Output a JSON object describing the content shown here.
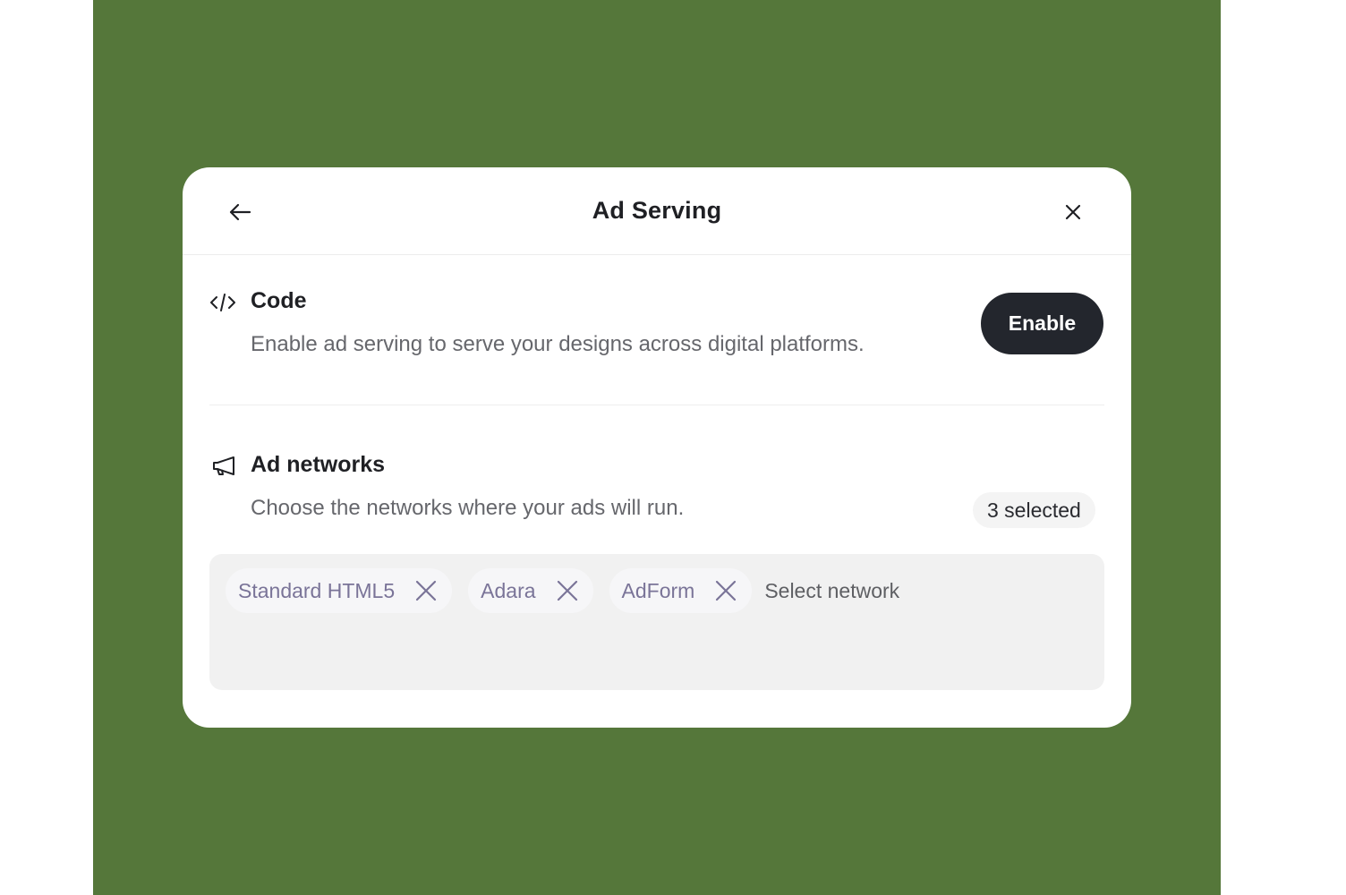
{
  "dialog": {
    "title": "Ad Serving"
  },
  "code_section": {
    "icon": "code-icon",
    "title": "Code",
    "description": "Enable ad serving to serve your designs across digital platforms.",
    "enable_label": "Enable"
  },
  "networks_section": {
    "icon": "megaphone-icon",
    "title": "Ad networks",
    "description": "Choose the networks where your ads will run.",
    "count_label": "3 selected",
    "chips": [
      {
        "label": "Standard HTML5"
      },
      {
        "label": "Adara"
      },
      {
        "label": "AdForm"
      }
    ],
    "placeholder": "Select network"
  },
  "colors": {
    "background": "#55773a",
    "primary_button": "#23262d",
    "chip_text": "#7a7498"
  }
}
